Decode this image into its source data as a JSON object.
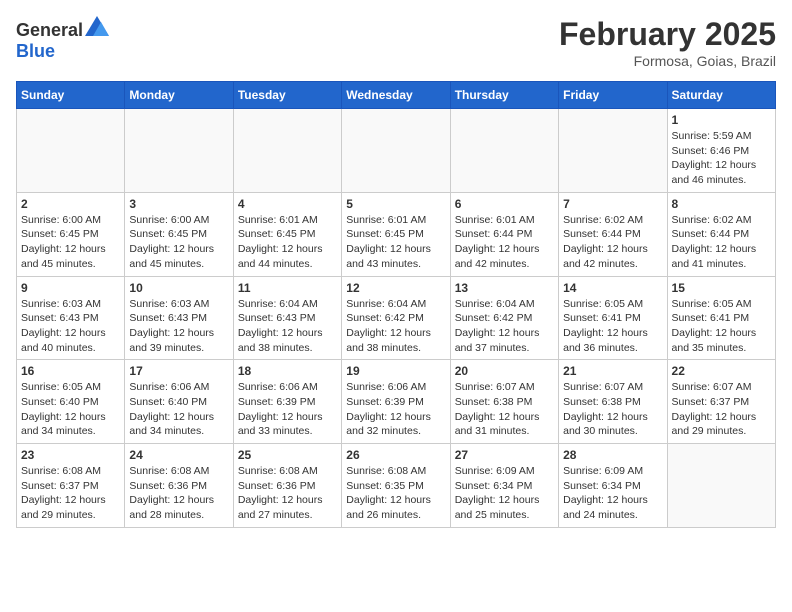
{
  "header": {
    "logo_general": "General",
    "logo_blue": "Blue",
    "month": "February 2025",
    "location": "Formosa, Goias, Brazil"
  },
  "days_of_week": [
    "Sunday",
    "Monday",
    "Tuesday",
    "Wednesday",
    "Thursday",
    "Friday",
    "Saturday"
  ],
  "weeks": [
    [
      {
        "day": "",
        "info": ""
      },
      {
        "day": "",
        "info": ""
      },
      {
        "day": "",
        "info": ""
      },
      {
        "day": "",
        "info": ""
      },
      {
        "day": "",
        "info": ""
      },
      {
        "day": "",
        "info": ""
      },
      {
        "day": "1",
        "info": "Sunrise: 5:59 AM\nSunset: 6:46 PM\nDaylight: 12 hours and 46 minutes."
      }
    ],
    [
      {
        "day": "2",
        "info": "Sunrise: 6:00 AM\nSunset: 6:45 PM\nDaylight: 12 hours and 45 minutes."
      },
      {
        "day": "3",
        "info": "Sunrise: 6:00 AM\nSunset: 6:45 PM\nDaylight: 12 hours and 45 minutes."
      },
      {
        "day": "4",
        "info": "Sunrise: 6:01 AM\nSunset: 6:45 PM\nDaylight: 12 hours and 44 minutes."
      },
      {
        "day": "5",
        "info": "Sunrise: 6:01 AM\nSunset: 6:45 PM\nDaylight: 12 hours and 43 minutes."
      },
      {
        "day": "6",
        "info": "Sunrise: 6:01 AM\nSunset: 6:44 PM\nDaylight: 12 hours and 42 minutes."
      },
      {
        "day": "7",
        "info": "Sunrise: 6:02 AM\nSunset: 6:44 PM\nDaylight: 12 hours and 42 minutes."
      },
      {
        "day": "8",
        "info": "Sunrise: 6:02 AM\nSunset: 6:44 PM\nDaylight: 12 hours and 41 minutes."
      }
    ],
    [
      {
        "day": "9",
        "info": "Sunrise: 6:03 AM\nSunset: 6:43 PM\nDaylight: 12 hours and 40 minutes."
      },
      {
        "day": "10",
        "info": "Sunrise: 6:03 AM\nSunset: 6:43 PM\nDaylight: 12 hours and 39 minutes."
      },
      {
        "day": "11",
        "info": "Sunrise: 6:04 AM\nSunset: 6:43 PM\nDaylight: 12 hours and 38 minutes."
      },
      {
        "day": "12",
        "info": "Sunrise: 6:04 AM\nSunset: 6:42 PM\nDaylight: 12 hours and 38 minutes."
      },
      {
        "day": "13",
        "info": "Sunrise: 6:04 AM\nSunset: 6:42 PM\nDaylight: 12 hours and 37 minutes."
      },
      {
        "day": "14",
        "info": "Sunrise: 6:05 AM\nSunset: 6:41 PM\nDaylight: 12 hours and 36 minutes."
      },
      {
        "day": "15",
        "info": "Sunrise: 6:05 AM\nSunset: 6:41 PM\nDaylight: 12 hours and 35 minutes."
      }
    ],
    [
      {
        "day": "16",
        "info": "Sunrise: 6:05 AM\nSunset: 6:40 PM\nDaylight: 12 hours and 34 minutes."
      },
      {
        "day": "17",
        "info": "Sunrise: 6:06 AM\nSunset: 6:40 PM\nDaylight: 12 hours and 34 minutes."
      },
      {
        "day": "18",
        "info": "Sunrise: 6:06 AM\nSunset: 6:39 PM\nDaylight: 12 hours and 33 minutes."
      },
      {
        "day": "19",
        "info": "Sunrise: 6:06 AM\nSunset: 6:39 PM\nDaylight: 12 hours and 32 minutes."
      },
      {
        "day": "20",
        "info": "Sunrise: 6:07 AM\nSunset: 6:38 PM\nDaylight: 12 hours and 31 minutes."
      },
      {
        "day": "21",
        "info": "Sunrise: 6:07 AM\nSunset: 6:38 PM\nDaylight: 12 hours and 30 minutes."
      },
      {
        "day": "22",
        "info": "Sunrise: 6:07 AM\nSunset: 6:37 PM\nDaylight: 12 hours and 29 minutes."
      }
    ],
    [
      {
        "day": "23",
        "info": "Sunrise: 6:08 AM\nSunset: 6:37 PM\nDaylight: 12 hours and 29 minutes."
      },
      {
        "day": "24",
        "info": "Sunrise: 6:08 AM\nSunset: 6:36 PM\nDaylight: 12 hours and 28 minutes."
      },
      {
        "day": "25",
        "info": "Sunrise: 6:08 AM\nSunset: 6:36 PM\nDaylight: 12 hours and 27 minutes."
      },
      {
        "day": "26",
        "info": "Sunrise: 6:08 AM\nSunset: 6:35 PM\nDaylight: 12 hours and 26 minutes."
      },
      {
        "day": "27",
        "info": "Sunrise: 6:09 AM\nSunset: 6:34 PM\nDaylight: 12 hours and 25 minutes."
      },
      {
        "day": "28",
        "info": "Sunrise: 6:09 AM\nSunset: 6:34 PM\nDaylight: 12 hours and 24 minutes."
      },
      {
        "day": "",
        "info": ""
      }
    ]
  ]
}
